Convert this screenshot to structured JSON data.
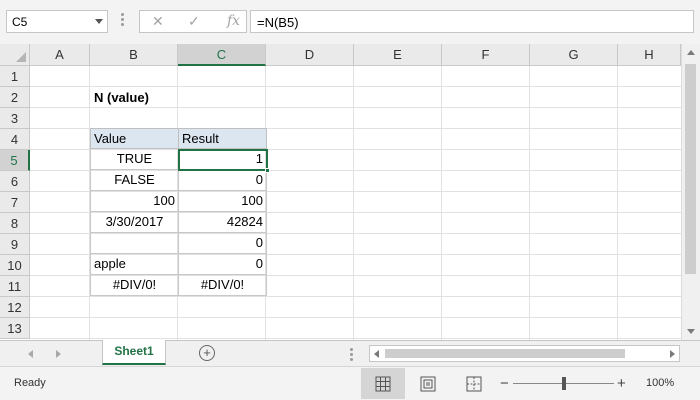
{
  "formula_bar": {
    "name_box": "C5",
    "cancel_icon": "✕",
    "enter_icon": "✓",
    "fx_label": "fx",
    "formula": "=N(B5)"
  },
  "columns": [
    "A",
    "B",
    "C",
    "D",
    "E",
    "F",
    "G",
    "H"
  ],
  "rows": [
    "1",
    "2",
    "3",
    "4",
    "5",
    "6",
    "7",
    "8",
    "9",
    "10",
    "11",
    "12",
    "13"
  ],
  "selected": {
    "column": "C",
    "row": "5"
  },
  "sheet": {
    "title": "N (value)",
    "table_headers": [
      "Value",
      "Result"
    ],
    "table_rows": [
      {
        "value": "TRUE",
        "result": "1"
      },
      {
        "value": "FALSE",
        "result": "0"
      },
      {
        "value": "100",
        "result": "100"
      },
      {
        "value": "3/30/2017",
        "result": "42824"
      },
      {
        "value": "",
        "result": "0"
      },
      {
        "value": "apple",
        "result": "0"
      },
      {
        "value": "#DIV/0!",
        "result": "#DIV/0!"
      }
    ]
  },
  "tabs": {
    "sheet_name": "Sheet1",
    "add_sheet_icon": "+"
  },
  "status": {
    "ready": "Ready",
    "zoom_minus": "−",
    "zoom_plus": "+",
    "zoom": "100%",
    "zoom_level_percent": 100
  },
  "colors": {
    "accent": "#217346",
    "table_header_fill": "#dce6f1"
  }
}
